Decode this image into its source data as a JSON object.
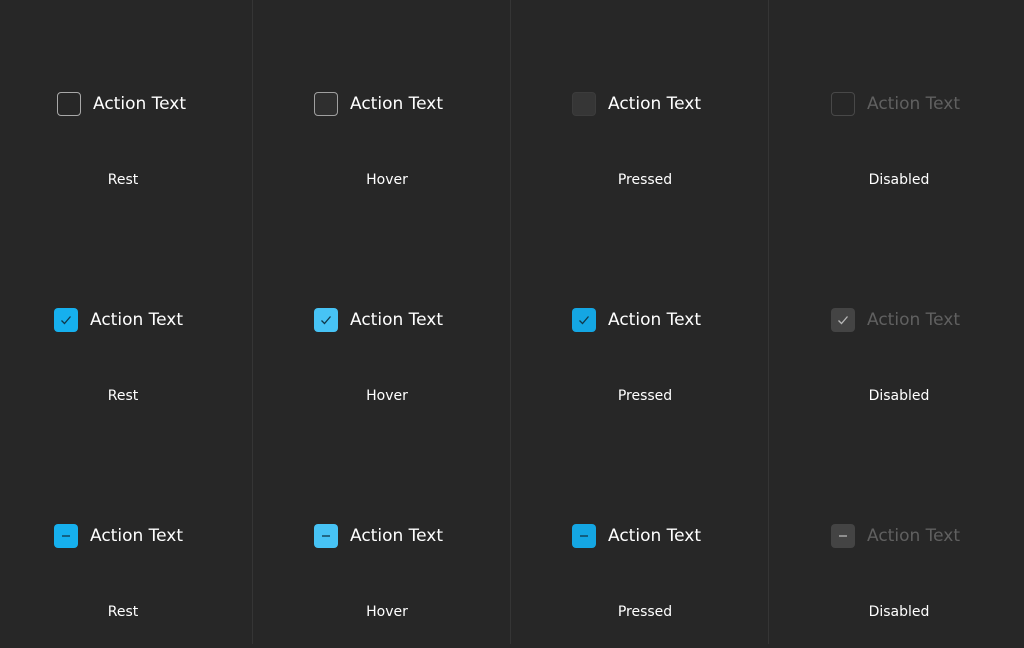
{
  "label_text": "Action Text",
  "colors": {
    "background": "#272727",
    "accent_rest": "#16b0ee",
    "accent_hover": "#47c3f5",
    "accent_pressed": "#14a6e3",
    "disabled_fill": "#444444",
    "disabled_text": "#606060"
  },
  "rows": [
    {
      "type": "unchecked",
      "cells": [
        {
          "state": "Rest",
          "label": "Action Text"
        },
        {
          "state": "Hover",
          "label": "Action Text"
        },
        {
          "state": "Pressed",
          "label": "Action Text"
        },
        {
          "state": "Disabled",
          "label": "Action Text"
        }
      ]
    },
    {
      "type": "checked",
      "icon": "checkmark-icon",
      "cells": [
        {
          "state": "Rest",
          "label": "Action Text"
        },
        {
          "state": "Hover",
          "label": "Action Text"
        },
        {
          "state": "Pressed",
          "label": "Action Text"
        },
        {
          "state": "Disabled",
          "label": "Action Text"
        }
      ]
    },
    {
      "type": "indeterminate",
      "icon": "dash-icon",
      "cells": [
        {
          "state": "Rest",
          "label": "Action Text"
        },
        {
          "state": "Hover",
          "label": "Action Text"
        },
        {
          "state": "Pressed",
          "label": "Action Text"
        },
        {
          "state": "Disabled",
          "label": "Action Text"
        }
      ]
    }
  ]
}
